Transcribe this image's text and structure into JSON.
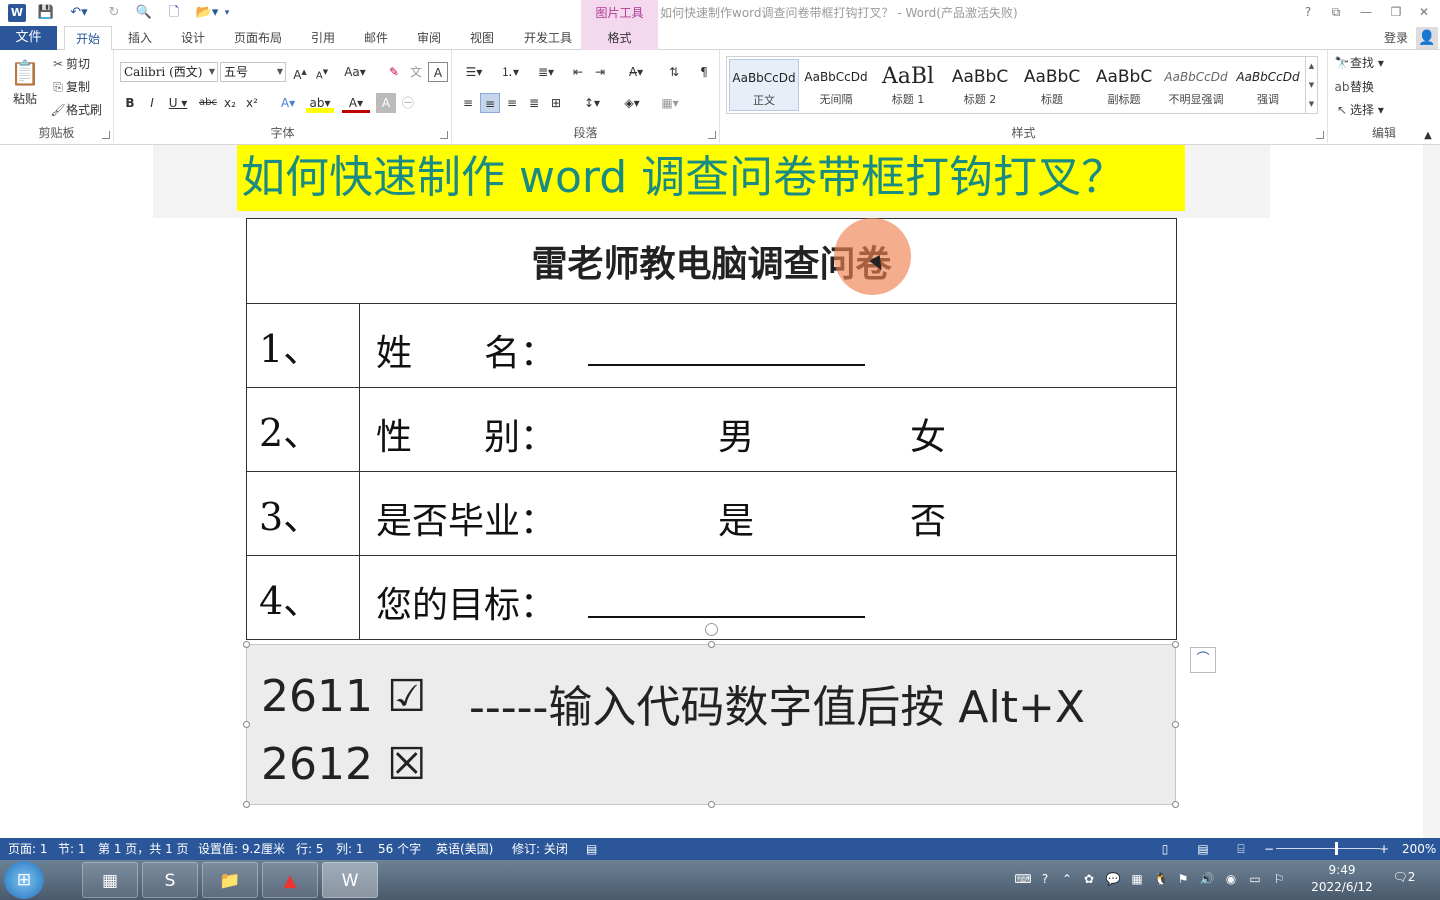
{
  "titlebar": {
    "contextual_header": "图片工具",
    "doc_title": "如何快速制作word调查问卷带框打钩打叉？ - Word(产品激活失败)",
    "help": "?",
    "ribbon_display": "⧉",
    "minimize": "—",
    "restore": "❐",
    "close": "✕"
  },
  "tabs": {
    "file": "文件",
    "items": [
      "开始",
      "插入",
      "设计",
      "页面布局",
      "引用",
      "邮件",
      "审阅",
      "视图",
      "开发工具"
    ],
    "format": "格式",
    "login": "登录"
  },
  "ribbon": {
    "clipboard": {
      "paste": "粘贴",
      "cut": "剪切",
      "copy": "复制",
      "format_painter": "格式刷",
      "label": "剪贴板"
    },
    "font": {
      "font_name": "Calibri (西文)",
      "font_size": "五号",
      "label": "字体"
    },
    "paragraph": {
      "label": "段落"
    },
    "styles": {
      "label": "样式",
      "items": [
        {
          "preview": "AaBbCcDd",
          "name": "正文"
        },
        {
          "preview": "AaBbCcDd",
          "name": "无间隔"
        },
        {
          "preview": "AaBl",
          "name": "标题 1"
        },
        {
          "preview": "AaBbC",
          "name": "标题 2"
        },
        {
          "preview": "AaBbC",
          "name": "标题"
        },
        {
          "preview": "AaBbC",
          "name": "副标题"
        },
        {
          "preview": "AaBbCcDd",
          "name": "不明显强调"
        },
        {
          "preview": "AaBbCcDd",
          "name": "强调"
        }
      ]
    },
    "editing": {
      "find": "查找",
      "replace": "替换",
      "select": "选择",
      "label": "编辑"
    }
  },
  "document": {
    "banner": "如何快速制作 word 调查问卷带框打钩打叉？",
    "table_title": "雷老师教电脑调查问卷",
    "rows": [
      {
        "num": "1、",
        "label": "姓　　名：",
        "opt1": "",
        "opt2": ""
      },
      {
        "num": "2、",
        "label": "性　　别：",
        "opt1": "男",
        "opt2": "女"
      },
      {
        "num": "3、",
        "label": "是否毕业：",
        "opt1": "是",
        "opt2": "否"
      },
      {
        "num": "4、",
        "label": "您的目标：",
        "opt1": "",
        "opt2": ""
      }
    ],
    "image": {
      "code1": "2611",
      "sym1": "☑",
      "code2": "2612",
      "sym2": "☒",
      "note": "-----输入代码数字值后按 Alt+X"
    }
  },
  "status": {
    "page": "页面: 1",
    "section": "节: 1",
    "page_of": "第 1 页，共 1 页",
    "position": "设置值: 9.2厘米",
    "line": "行: 5",
    "column": "列: 1",
    "words": "56 个字",
    "language": "英语(美国)",
    "track": "修订: 关闭",
    "zoom": "200%"
  },
  "taskbar": {
    "time": "9:49",
    "date": "2022/6/12",
    "notifications": "2"
  },
  "colors": {
    "accent": "#2b579a",
    "banner_bg": "#ffff00",
    "banner_text": "#1a8b82",
    "contextual": "#f4d9ee"
  }
}
